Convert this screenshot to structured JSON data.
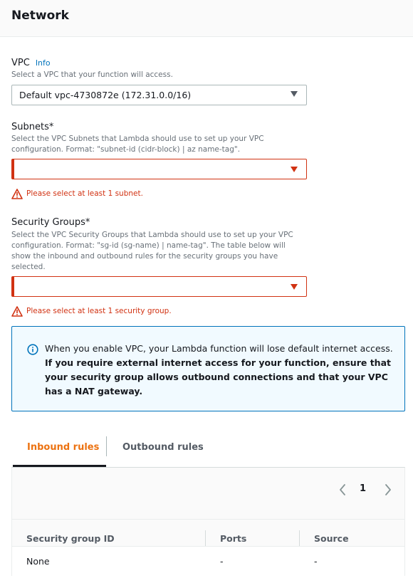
{
  "header": {
    "title": "Network"
  },
  "vpc": {
    "label": "VPC",
    "info": "Info",
    "description": "Select a VPC that your function will access.",
    "selected": "Default vpc-4730872e (172.31.0.0/16)"
  },
  "subnets": {
    "label": "Subnets*",
    "description": "Select the VPC Subnets that Lambda should use to set up your VPC configuration. Format: \"subnet-id (cidr-block) | az name-tag\".",
    "selected": "",
    "error": "Please select at least 1 subnet."
  },
  "security_groups": {
    "label": "Security Groups*",
    "description": "Select the VPC Security Groups that Lambda should use to set up your VPC configuration. Format: \"sg-id (sg-name) | name-tag\". The table below will show the inbound and outbound rules for the security groups you have selected.",
    "selected": "",
    "error": "Please select at least 1 security group."
  },
  "alert": {
    "text_plain": "When you enable VPC, your Lambda function will lose default internet access. ",
    "text_bold": "If you require external internet access for your function, ensure that your security group allows outbound connections and that your VPC has a NAT gateway."
  },
  "tabs": {
    "inbound": "Inbound rules",
    "outbound": "Outbound rules"
  },
  "table": {
    "page": "1",
    "columns": [
      "Security group ID",
      "Ports",
      "Source"
    ],
    "rows": [
      [
        "None",
        "-",
        "-"
      ]
    ]
  },
  "colors": {
    "error": "#d13212",
    "info": "#0073bb",
    "accent": "#ec7211"
  }
}
